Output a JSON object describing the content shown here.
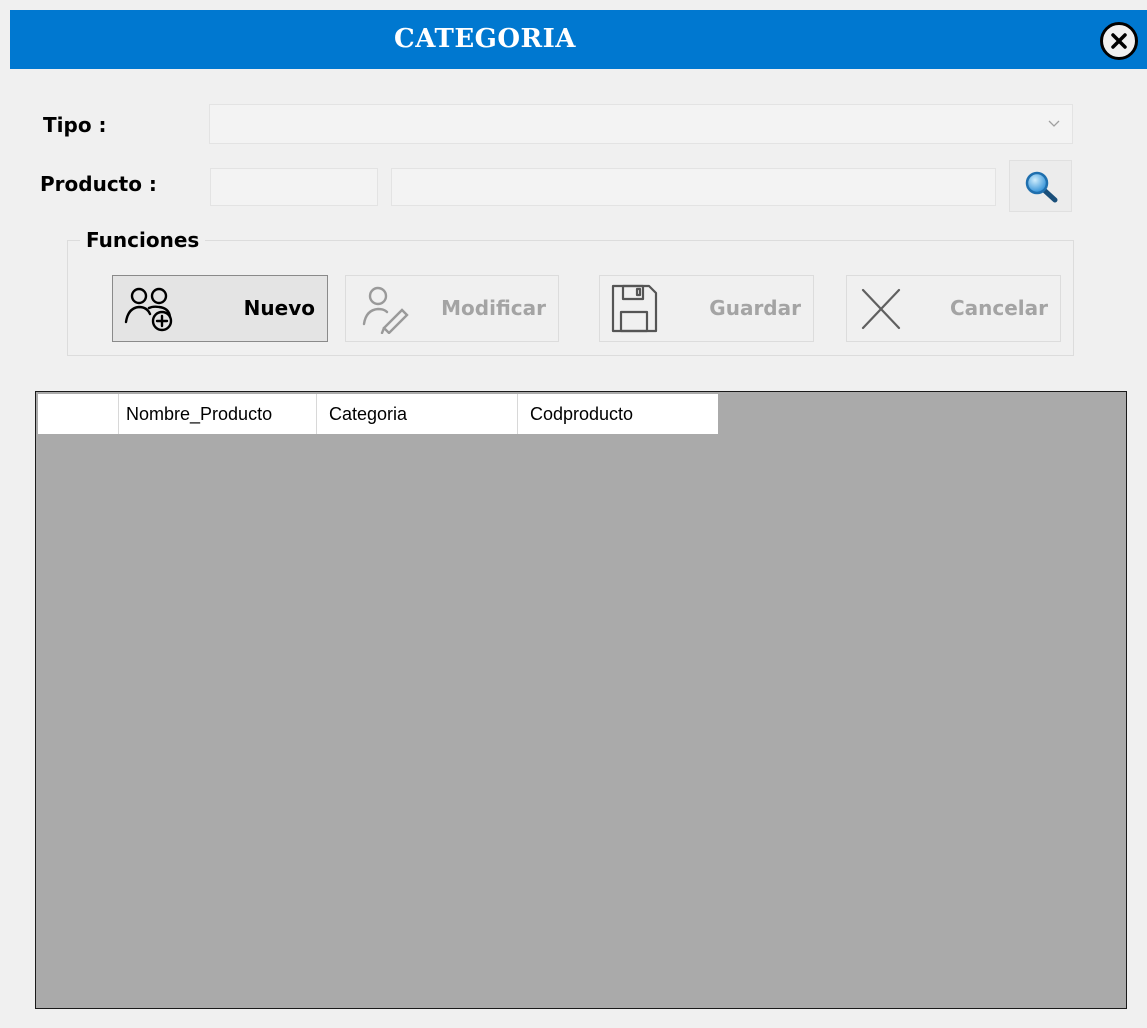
{
  "window": {
    "title": "CATEGORIA",
    "close_icon": "close-circle-icon"
  },
  "form": {
    "tipo_label": "Tipo :",
    "tipo_value": "",
    "producto_label": "Producto :",
    "producto_code_value": "",
    "producto_name_value": "",
    "search_icon": "magnifier-icon"
  },
  "functions": {
    "group_label": "Funciones",
    "buttons": [
      {
        "label": "Nuevo",
        "icon": "add-users-icon",
        "enabled": true
      },
      {
        "label": "Modificar",
        "icon": "edit-user-icon",
        "enabled": false
      },
      {
        "label": "Guardar",
        "icon": "save-icon",
        "enabled": false
      },
      {
        "label": "Cancelar",
        "icon": "cancel-icon",
        "enabled": false
      }
    ]
  },
  "grid": {
    "columns": [
      "Nombre_Producto",
      "Categoria",
      "Codproducto"
    ],
    "rows": []
  },
  "colors": {
    "title_bar": "#0078d0",
    "grid_background": "#aaaaaa",
    "window_background": "#f0f0f0"
  }
}
